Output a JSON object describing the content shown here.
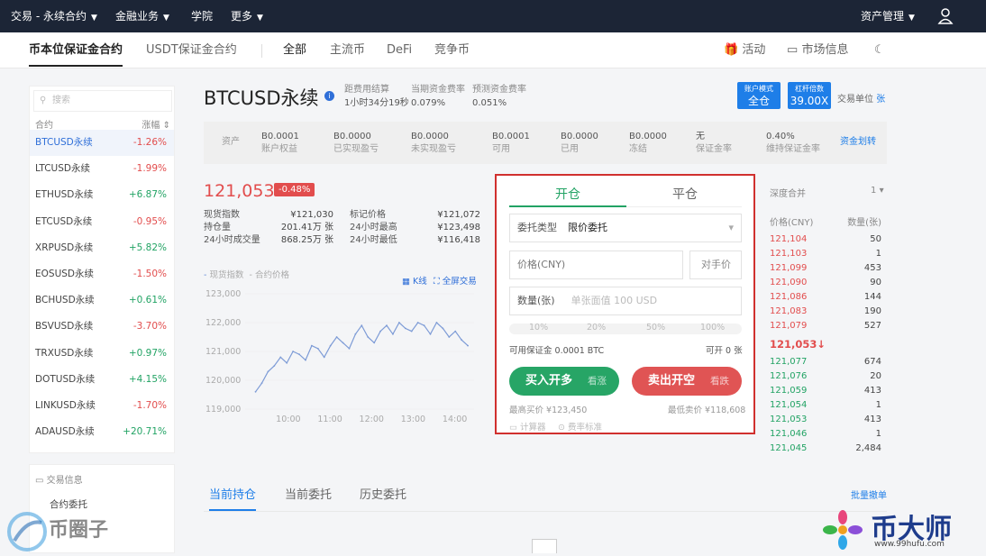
{
  "topnav": {
    "trade": "交易 - 永续合约",
    "finance": "金融业务",
    "academy": "学院",
    "more": "更多",
    "asset": "资产管理"
  },
  "subnav": {
    "coin_margin": "币本位保证金合约",
    "usdt_margin": "USDT保证金合约",
    "all": "全部",
    "mainstream": "主流币",
    "defi": "DeFi",
    "competition": "竞争币",
    "activity": "活动",
    "market_info": "市场信息"
  },
  "left": {
    "search_placeholder": "搜索",
    "col_contract": "合约",
    "col_change": "涨幅",
    "markets": [
      {
        "name": "BTCUSD永续",
        "change": "-1.26%",
        "dir": "down"
      },
      {
        "name": "LTCUSD永续",
        "change": "-1.99%",
        "dir": "down"
      },
      {
        "name": "ETHUSD永续",
        "change": "+6.87%",
        "dir": "up"
      },
      {
        "name": "ETCUSD永续",
        "change": "-0.95%",
        "dir": "down"
      },
      {
        "name": "XRPUSD永续",
        "change": "+5.82%",
        "dir": "up"
      },
      {
        "name": "EOSUSD永续",
        "change": "-1.50%",
        "dir": "down"
      },
      {
        "name": "BCHUSD永续",
        "change": "+0.61%",
        "dir": "up"
      },
      {
        "name": "BSVUSD永续",
        "change": "-3.70%",
        "dir": "down"
      },
      {
        "name": "TRXUSD永续",
        "change": "+0.97%",
        "dir": "up"
      },
      {
        "name": "DOTUSD永续",
        "change": "+4.15%",
        "dir": "up"
      },
      {
        "name": "LINKUSD永续",
        "change": "-1.70%",
        "dir": "down"
      },
      {
        "name": "ADAUSD永续",
        "change": "+20.71%",
        "dir": "up"
      }
    ],
    "info_title": "交易信息",
    "info_item": "合约委托"
  },
  "header": {
    "title": "BTCUSD永续",
    "settle_label": "距费用结算",
    "settle_value": "1小时34分19秒",
    "funding_label": "当期资金费率",
    "funding_value": "0.079%",
    "pred_label": "预测资金费率",
    "pred_value": "0.051%",
    "account_mode_label": "账户模式",
    "account_mode_value": "全仓",
    "leverage_label": "杠杆倍数",
    "leverage_value": "39.00X",
    "unit_label": "交易单位",
    "unit_value": "张"
  },
  "assets": {
    "label": "资产",
    "items": [
      {
        "v": "B0.0001",
        "l": "账户权益"
      },
      {
        "v": "B0.0000",
        "l": "已实现盈亏"
      },
      {
        "v": "B0.0000",
        "l": "未实现盈亏"
      },
      {
        "v": "B0.0001",
        "l": "可用"
      },
      {
        "v": "B0.0000",
        "l": "已用"
      },
      {
        "v": "B0.0000",
        "l": "冻结"
      },
      {
        "v": "无",
        "l": "保证金率"
      },
      {
        "v": "0.40%",
        "l": "维持保证金率"
      }
    ],
    "transfer": "资金划转"
  },
  "ticker": {
    "price": "121,053",
    "change": "-0.48%",
    "stats": [
      {
        "k": "现货指数",
        "v": "¥121,030"
      },
      {
        "k": "持仓量",
        "v": "201.41万 张"
      },
      {
        "k": "24小时成交量",
        "v": "868.25万 张"
      },
      {
        "k": "标记价格",
        "v": "¥121,072"
      },
      {
        "k": "24小时最高",
        "v": "¥123,498"
      },
      {
        "k": "24小时最低",
        "v": "¥116,418"
      }
    ]
  },
  "chart": {
    "legend_spot": "现货指数",
    "legend_contract": "合约价格",
    "kline": "K线",
    "fullscreen": "全屏交易"
  },
  "chart_data": {
    "type": "line",
    "y_ticks": [
      "123,000",
      "122,000",
      "121,000",
      "120,000",
      "119,000"
    ],
    "x_ticks": [
      "10:00",
      "11:00",
      "12:00",
      "13:00",
      "14:00"
    ],
    "ylim": [
      119000,
      123000
    ],
    "x": [
      9.25,
      9.4,
      9.55,
      9.7,
      9.85,
      10.0,
      10.15,
      10.3,
      10.45,
      10.6,
      10.75,
      10.9,
      11.05,
      11.2,
      11.35,
      11.5,
      11.65,
      11.8,
      11.95,
      12.1,
      12.25,
      12.4,
      12.55,
      12.7,
      12.85,
      13.0,
      13.15,
      13.3,
      13.45,
      13.6,
      13.75,
      13.9,
      14.05,
      14.2,
      14.35
    ],
    "values": [
      119600,
      119900,
      120300,
      120500,
      120800,
      120600,
      121000,
      120900,
      120700,
      121200,
      121100,
      120800,
      121200,
      121500,
      121300,
      121100,
      121600,
      121900,
      121500,
      121300,
      121700,
      121900,
      121600,
      122000,
      121800,
      121700,
      122000,
      121900,
      121600,
      122000,
      121800,
      121500,
      121700,
      121400,
      121200
    ]
  },
  "order": {
    "tab_open": "开仓",
    "tab_close": "平仓",
    "type_label": "委托类型",
    "type_value": "限价委托",
    "price_placeholder": "价格(CNY)",
    "counter": "对手价",
    "qty_label": "数量(张)",
    "qty_placeholder": "单张面值 100 USD",
    "pcts": [
      "10%",
      "20%",
      "50%",
      "100%"
    ],
    "avail": "可用保证金 0.0001 BTC",
    "openable": "可开 0 张",
    "buy_label": "买入开多",
    "buy_sub": "看涨",
    "sell_label": "卖出开空",
    "sell_sub": "看跌",
    "buy_price": "最高买价 ¥123,450",
    "sell_price": "最低卖价 ¥118,608",
    "calculator": "计算器",
    "fee": "费率标准"
  },
  "depth": {
    "merge_label": "深度合并",
    "merge_value": "1",
    "col_price": "价格(CNY)",
    "col_qty": "数量(张)",
    "asks": [
      {
        "p": "121,104",
        "q": "50"
      },
      {
        "p": "121,103",
        "q": "1"
      },
      {
        "p": "121,099",
        "q": "453"
      },
      {
        "p": "121,090",
        "q": "90"
      },
      {
        "p": "121,086",
        "q": "144"
      },
      {
        "p": "121,083",
        "q": "190"
      },
      {
        "p": "121,079",
        "q": "527"
      }
    ],
    "last": "121,053↓",
    "bids": [
      {
        "p": "121,077",
        "q": "674"
      },
      {
        "p": "121,076",
        "q": "20"
      },
      {
        "p": "121,059",
        "q": "413"
      },
      {
        "p": "121,054",
        "q": "1"
      },
      {
        "p": "121,053",
        "q": "413"
      },
      {
        "p": "121,046",
        "q": "1"
      },
      {
        "p": "121,045",
        "q": "2,484"
      }
    ]
  },
  "bottom": {
    "tab_positions": "当前持仓",
    "tab_orders": "当前委托",
    "tab_history": "历史委托",
    "batch_cancel": "批量撤单"
  },
  "watermark": {
    "left": "币圈子",
    "right": "币大师",
    "right_url": "www.99hufu.com"
  }
}
